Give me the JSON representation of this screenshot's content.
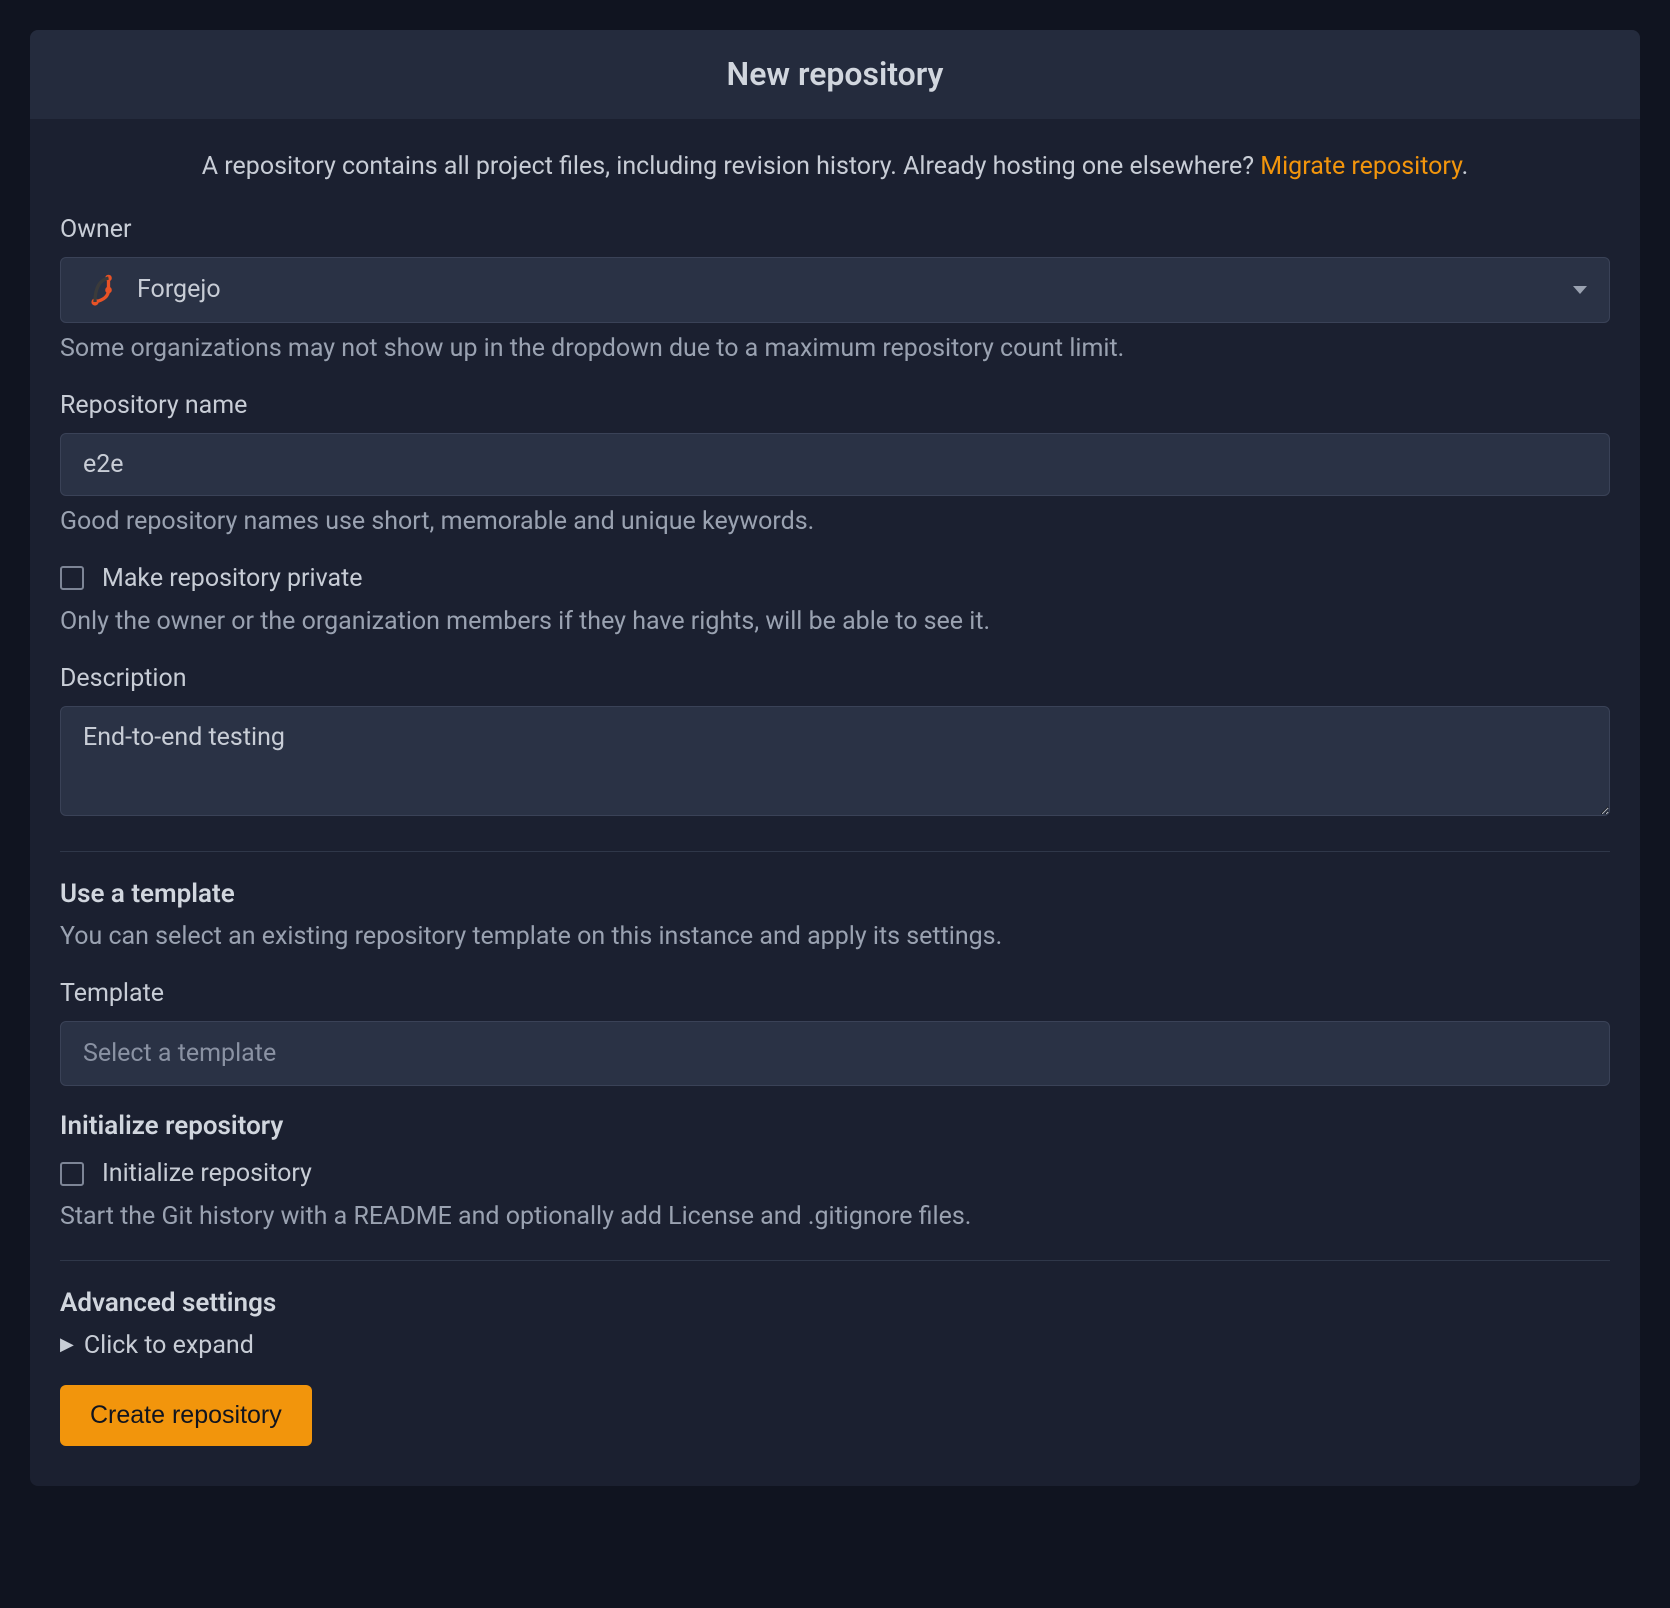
{
  "header": {
    "title": "New repository"
  },
  "intro": {
    "text_before": "A repository contains all project files, including revision history. Already hosting one elsewhere? ",
    "link_text": "Migrate repository",
    "text_after": "."
  },
  "owner": {
    "label": "Owner",
    "selected": "Forgejo",
    "help": "Some organizations may not show up in the dropdown due to a maximum repository count limit."
  },
  "repo_name": {
    "label": "Repository name",
    "value": "e2e",
    "help": "Good repository names use short, memorable and unique keywords."
  },
  "private": {
    "label": "Make repository private",
    "help": "Only the owner or the organization members if they have rights, will be able to see it."
  },
  "description": {
    "label": "Description",
    "value": "End-to-end testing"
  },
  "template_section": {
    "title": "Use a template",
    "sub": "You can select an existing repository template on this instance and apply its settings.",
    "field_label": "Template",
    "placeholder": "Select a template"
  },
  "init_section": {
    "title": "Initialize repository",
    "checkbox_label": "Initialize repository",
    "help": "Start the Git history with a README and optionally add License and .gitignore files."
  },
  "advanced": {
    "title": "Advanced settings",
    "expand": "Click to expand"
  },
  "submit": {
    "label": "Create repository"
  }
}
